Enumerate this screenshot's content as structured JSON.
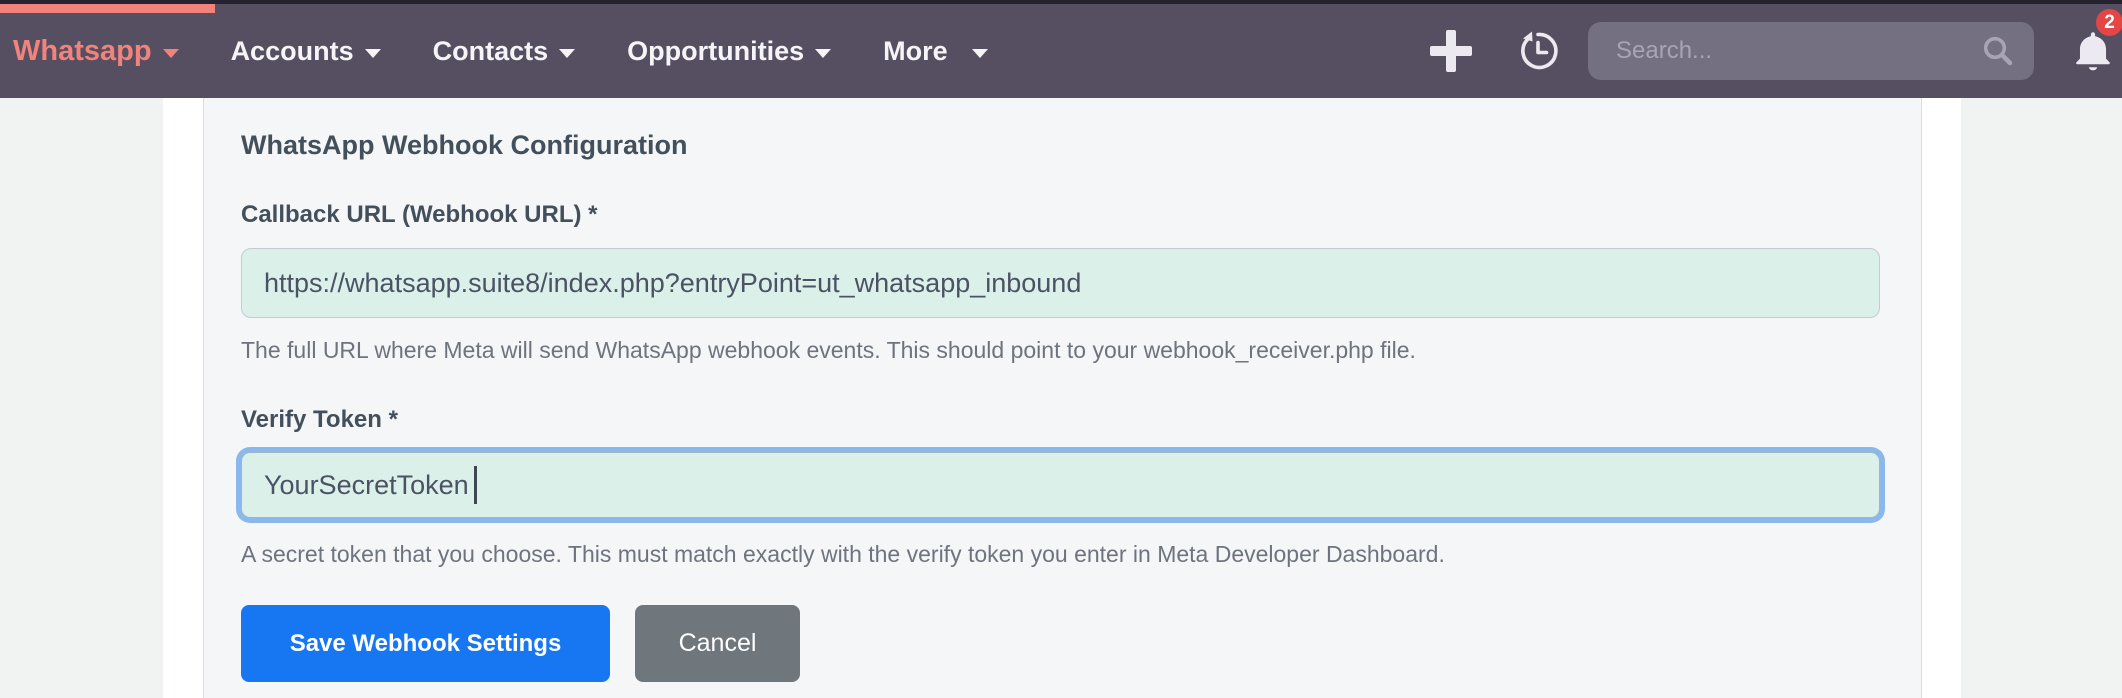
{
  "nav": {
    "active": {
      "label": "Whatsapp"
    },
    "menu": [
      {
        "label": "Accounts"
      },
      {
        "label": "Contacts"
      },
      {
        "label": "Opportunities"
      },
      {
        "label": "More"
      }
    ],
    "search_placeholder": "Search...",
    "notification_count": "2"
  },
  "form": {
    "heading": "WhatsApp Webhook Configuration",
    "fields": [
      {
        "label": "Callback URL (Webhook URL) *",
        "value": "https://whatsapp.suite8/index.php?entryPoint=ut_whatsapp_inbound",
        "help": "The full URL where Meta will send WhatsApp webhook events. This should point to your webhook_receiver.php file."
      },
      {
        "label": "Verify Token *",
        "value": "YourSecretToken",
        "help": "A secret token that you choose. This must match exactly with the verify token you enter in Meta Developer Dashboard."
      }
    ],
    "save_label": "Save Webhook Settings",
    "cancel_label": "Cancel"
  },
  "colors": {
    "navbar": "#564f62",
    "accent_salmon": "#f2837c",
    "primary_blue": "#1777f3",
    "badge_red": "#e64545",
    "input_mint": "#daf0e9",
    "focus_ring": "#8bb8ec",
    "panel_bg": "#f5f6f8"
  }
}
